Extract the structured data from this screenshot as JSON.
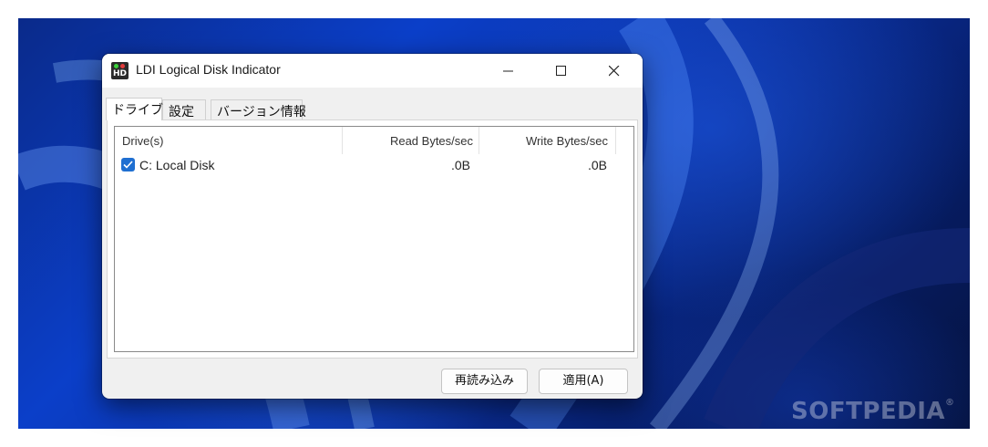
{
  "window": {
    "title": "LDI Logical Disk Indicator",
    "app_icon_text": "HD"
  },
  "tabs": [
    {
      "label": "ドライブ",
      "active": true
    },
    {
      "label": "設定",
      "active": false
    },
    {
      "label": "バージョン情報",
      "active": false
    }
  ],
  "table": {
    "columns": [
      "Drive(s)",
      "Read Bytes/sec",
      "Write Bytes/sec"
    ],
    "rows": [
      {
        "checked": true,
        "drive": "C: Local Disk",
        "read": ".0B",
        "write": ".0B"
      }
    ]
  },
  "buttons": {
    "reload": "再読み込み",
    "apply": "適用(A)"
  },
  "watermark": {
    "text": "SOFTPEDIA",
    "mark": "®"
  },
  "colors": {
    "checkbox": "#1f6fd1",
    "wallpaper": "#0b3fc9"
  }
}
